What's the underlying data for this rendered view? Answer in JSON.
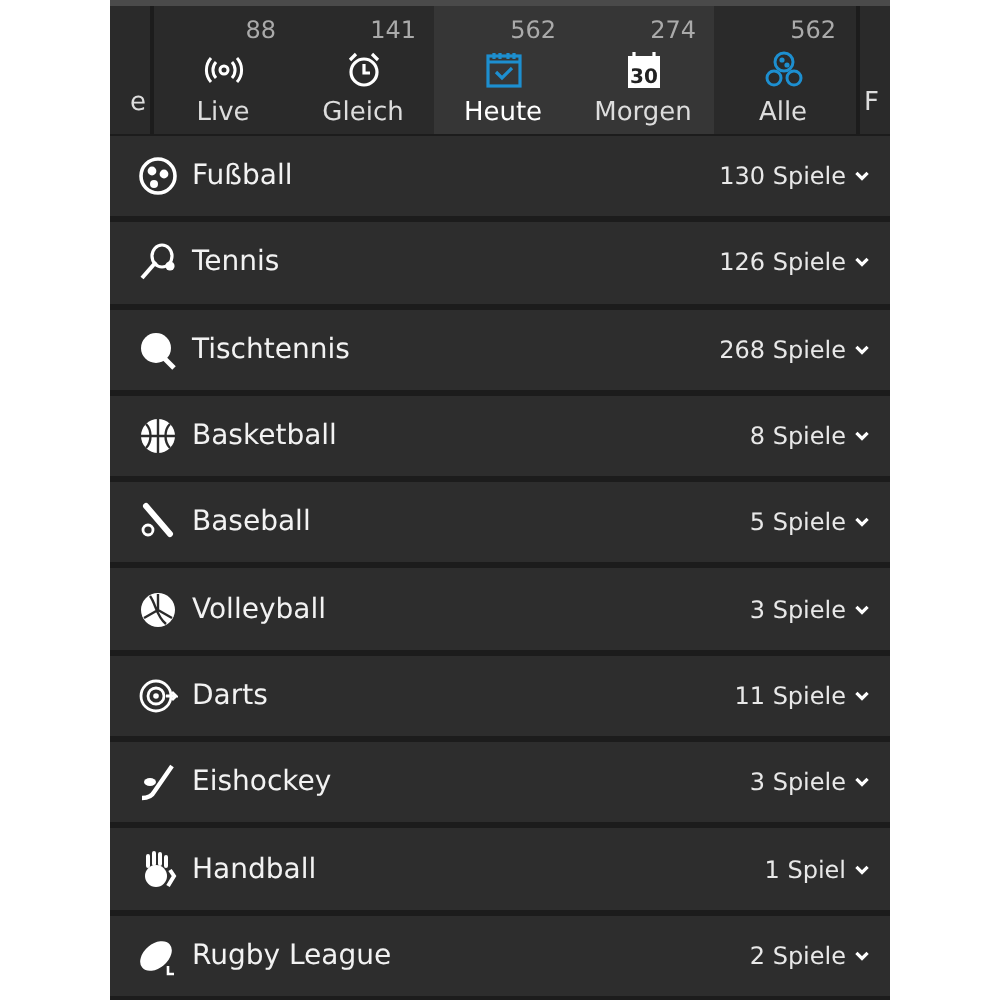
{
  "tabs": [
    {
      "kind": "partial",
      "label": "e",
      "selected": false,
      "highlighted": false
    },
    {
      "kind": "full",
      "label": "Live",
      "count": "88",
      "selected": false,
      "highlighted": false,
      "color": "#ffffff"
    },
    {
      "kind": "full",
      "label": "Gleich",
      "count": "141",
      "selected": false,
      "highlighted": false,
      "color": "#ffffff"
    },
    {
      "kind": "full",
      "label": "Heute",
      "count": "562",
      "selected": true,
      "highlighted": true,
      "color": "#1d8fd0"
    },
    {
      "kind": "full",
      "label": "Morgen",
      "count": "274",
      "icon_text": "30",
      "selected": false,
      "highlighted": true,
      "color": "#ffffff"
    },
    {
      "kind": "full",
      "label": "Alle",
      "count": "562",
      "selected": false,
      "highlighted": false,
      "color": "#1d8fd0"
    },
    {
      "kind": "partial",
      "label": "F",
      "selected": false,
      "highlighted": false
    }
  ],
  "sports": [
    {
      "name": "Fußball",
      "count": "130 Spiele"
    },
    {
      "name": "Tennis",
      "count": "126 Spiele"
    },
    {
      "name": "Tischtennis",
      "count": "268 Spiele"
    },
    {
      "name": "Basketball",
      "count": "8 Spiele"
    },
    {
      "name": "Baseball",
      "count": "5 Spiele"
    },
    {
      "name": "Volleyball",
      "count": "3 Spiele"
    },
    {
      "name": "Darts",
      "count": "11 Spiele"
    },
    {
      "name": "Eishockey",
      "count": "3 Spiele"
    },
    {
      "name": "Handball",
      "count": "1 Spiel"
    },
    {
      "name": "Rugby League",
      "count": "2 Spiele"
    }
  ]
}
